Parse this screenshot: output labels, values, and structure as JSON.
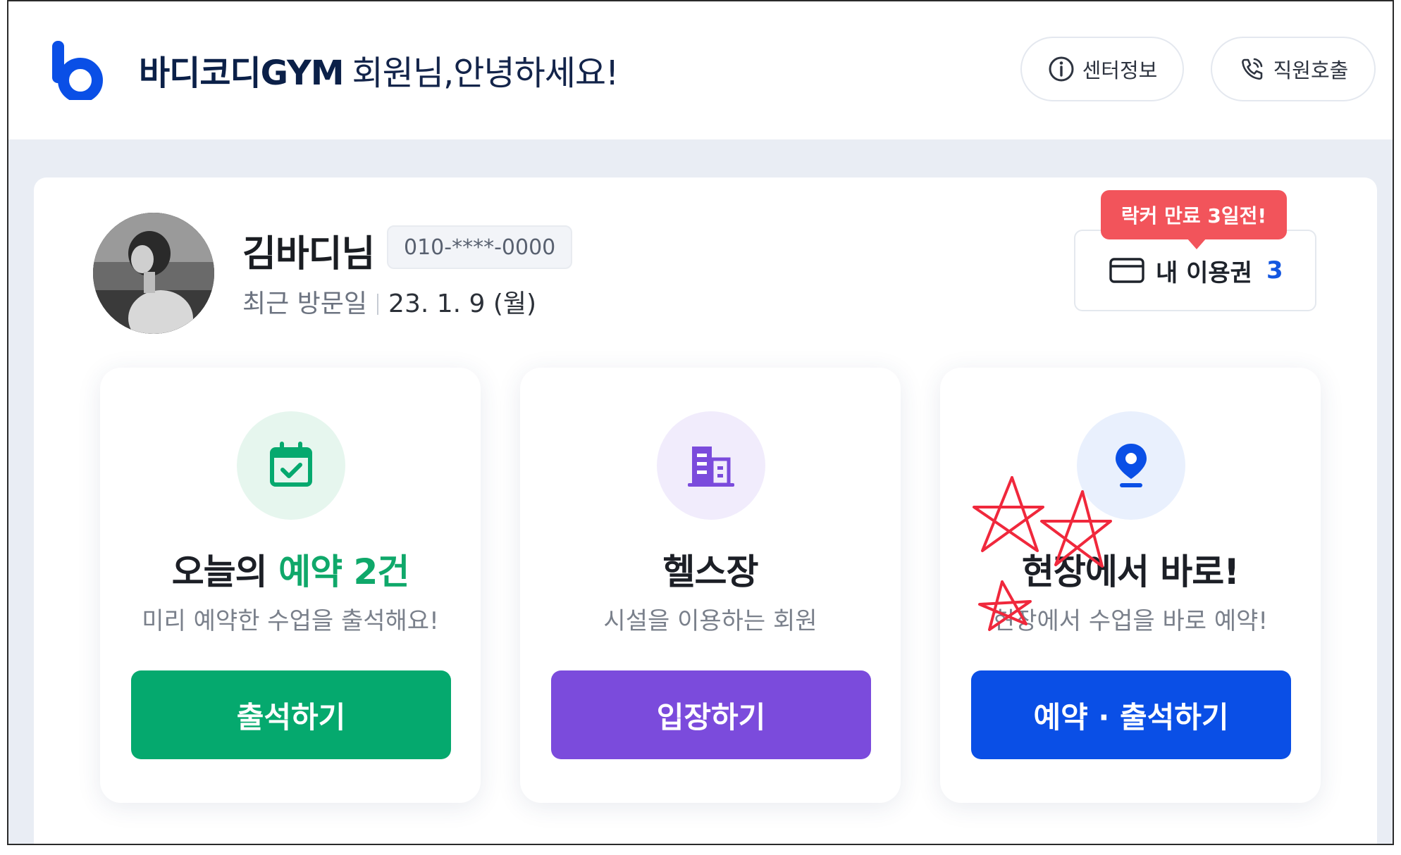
{
  "colors": {
    "brand_blue": "#0a4fe6",
    "green": "#05a96e",
    "purple": "#7b4bdc",
    "badge_red": "#f2545b",
    "title_navy": "#0b2048"
  },
  "header": {
    "title_brand": "바디코디GYM",
    "title_greeting": "회원님,안녕하세요!",
    "info_button": {
      "label": "센터정보",
      "icon": "info-circle-icon"
    },
    "call_button": {
      "label": "직원호출",
      "icon": "phone-call-icon"
    }
  },
  "profile": {
    "name": "김바디님",
    "phone": "010-****-0000",
    "last_visit_label": "최근 방문일",
    "last_visit_date": "23. 1. 9 (월)"
  },
  "ticket": {
    "locker_badge": "락커 만료 3일전!",
    "label": "내 이용권",
    "count": "3",
    "icon": "card-icon"
  },
  "tiles": [
    {
      "icon": "calendar-check-icon",
      "title_plain": "오늘의",
      "title_highlight": "예약 2건",
      "subtitle": "미리 예약한 수업을 출석해요!",
      "button": "출석하기"
    },
    {
      "icon": "building-icon",
      "title": "헬스장",
      "subtitle": "시설을 이용하는 회원",
      "button": "입장하기"
    },
    {
      "icon": "location-pin-icon",
      "title": "현장에서 바로!",
      "subtitle": "현장에서 수업을 바로 예약!",
      "button": "예약 · 출석하기"
    }
  ]
}
